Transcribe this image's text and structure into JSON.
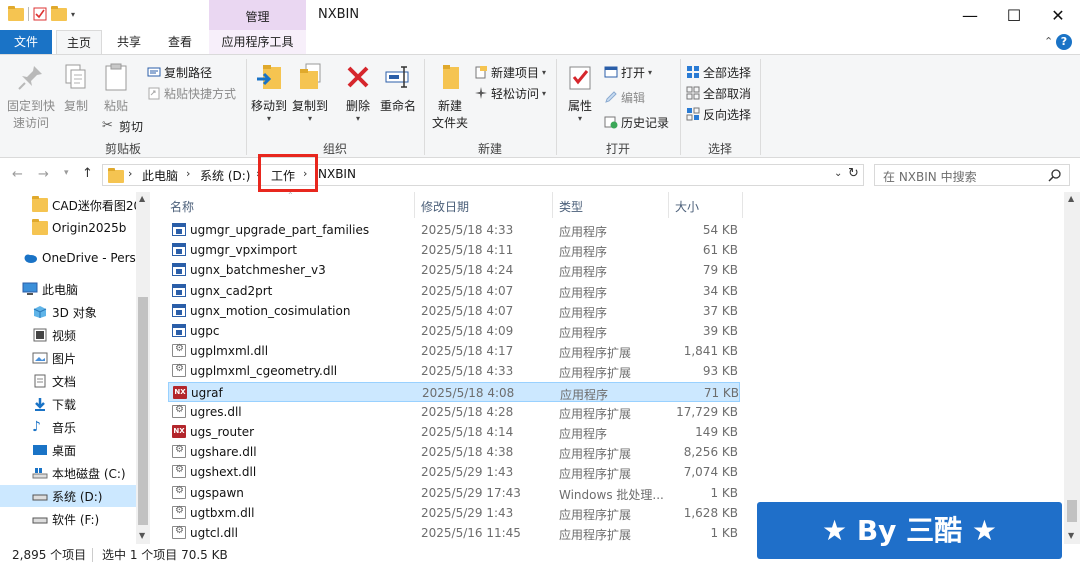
{
  "titlebar": {
    "context_label": "管理",
    "title": "NXBIN",
    "minimize": "—",
    "maximize": "☐",
    "close": "✕"
  },
  "tabs": {
    "file": "文件",
    "home": "主页",
    "share": "共享",
    "view": "查看",
    "app_tools": "应用程序工具"
  },
  "ribbon": {
    "pin": "固定到快速访问",
    "pin_l1": "固定到快",
    "pin_l2": "速访问",
    "copy": "复制",
    "paste": "粘贴",
    "copy_path": "复制路径",
    "paste_shortcut": "粘贴快捷方式",
    "cut": "剪切",
    "clipboard": "剪贴板",
    "move_to": "移动到",
    "copy_to": "复制到",
    "delete": "删除",
    "rename": "重命名",
    "organize": "组织",
    "new_folder_l1": "新建",
    "new_folder_l2": "文件夹",
    "new_item": "新建项目",
    "easy_access": "轻松访问",
    "new_group": "新建",
    "properties": "属性",
    "open": "打开",
    "edit": "编辑",
    "history": "历史记录",
    "open_group": "打开",
    "select_all": "全部选择",
    "select_none": "全部取消",
    "invert_select": "反向选择",
    "select_group": "选择"
  },
  "address": {
    "crumbs": [
      "此电脑",
      "系统 (D:)",
      "工作",
      "NXBIN"
    ],
    "search_placeholder": "在 NXBIN 中搜索"
  },
  "navpane": {
    "items": [
      {
        "label": "CAD迷你看图20",
        "icon": "folder-icon"
      },
      {
        "label": "Origin2025b",
        "icon": "folder-icon"
      },
      {
        "label": "OneDrive - Perso",
        "icon": "cloud-icon"
      },
      {
        "label": "此电脑",
        "icon": "computer-icon"
      },
      {
        "label": "3D 对象",
        "icon": "cube-icon"
      },
      {
        "label": "视频",
        "icon": "video-icon"
      },
      {
        "label": "图片",
        "icon": "picture-icon"
      },
      {
        "label": "文档",
        "icon": "document-icon"
      },
      {
        "label": "下载",
        "icon": "download-icon"
      },
      {
        "label": "音乐",
        "icon": "music-icon"
      },
      {
        "label": "桌面",
        "icon": "desktop-icon"
      },
      {
        "label": "本地磁盘 (C:)",
        "icon": "drive-icon"
      },
      {
        "label": "系统 (D:)",
        "icon": "drive-icon"
      },
      {
        "label": "软件 (F:)",
        "icon": "drive-icon"
      }
    ]
  },
  "columns": {
    "name": "名称",
    "date": "修改日期",
    "type": "类型",
    "size": "大小"
  },
  "files": [
    {
      "name": "ugmgr_upgrade_part_families",
      "date": "2025/5/18 4:33",
      "type": "应用程序",
      "size": "54 KB",
      "icon": "exe"
    },
    {
      "name": "ugmgr_vpximport",
      "date": "2025/5/18 4:11",
      "type": "应用程序",
      "size": "61 KB",
      "icon": "exe"
    },
    {
      "name": "ugnx_batchmesher_v3",
      "date": "2025/5/18 4:24",
      "type": "应用程序",
      "size": "79 KB",
      "icon": "exe"
    },
    {
      "name": "ugnx_cad2prt",
      "date": "2025/5/18 4:07",
      "type": "应用程序",
      "size": "34 KB",
      "icon": "exe"
    },
    {
      "name": "ugnx_motion_cosimulation",
      "date": "2025/5/18 4:07",
      "type": "应用程序",
      "size": "37 KB",
      "icon": "exe"
    },
    {
      "name": "ugpc",
      "date": "2025/5/18 4:09",
      "type": "应用程序",
      "size": "39 KB",
      "icon": "exe"
    },
    {
      "name": "ugplmxml.dll",
      "date": "2025/5/18 4:17",
      "type": "应用程序扩展",
      "size": "1,841 KB",
      "icon": "dll"
    },
    {
      "name": "ugplmxml_cgeometry.dll",
      "date": "2025/5/18 4:33",
      "type": "应用程序扩展",
      "size": "93 KB",
      "icon": "dll"
    },
    {
      "name": "ugraf",
      "date": "2025/5/18 4:08",
      "type": "应用程序",
      "size": "71 KB",
      "icon": "nx",
      "selected": true
    },
    {
      "name": "ugres.dll",
      "date": "2025/5/18 4:28",
      "type": "应用程序扩展",
      "size": "17,729 KB",
      "icon": "dll"
    },
    {
      "name": "ugs_router",
      "date": "2025/5/18 4:14",
      "type": "应用程序",
      "size": "149 KB",
      "icon": "nx"
    },
    {
      "name": "ugshare.dll",
      "date": "2025/5/18 4:38",
      "type": "应用程序扩展",
      "size": "8,256 KB",
      "icon": "dll"
    },
    {
      "name": "ugshext.dll",
      "date": "2025/5/29 1:43",
      "type": "应用程序扩展",
      "size": "7,074 KB",
      "icon": "dll"
    },
    {
      "name": "ugspawn",
      "date": "2025/5/29 17:43",
      "type": "Windows 批处理...",
      "size": "1 KB",
      "icon": "dll"
    },
    {
      "name": "ugtbxm.dll",
      "date": "2025/5/29 1:43",
      "type": "应用程序扩展",
      "size": "1,628 KB",
      "icon": "dll"
    },
    {
      "name": "ugtcl.dll",
      "date": "2025/5/16 11:45",
      "type": "应用程序扩展",
      "size": "1 KB",
      "icon": "dll"
    }
  ],
  "status": {
    "count": "2,895 个项目",
    "selected": "选中 1 个项目  70.5 KB"
  },
  "watermark": "★ By 三酷 ★"
}
